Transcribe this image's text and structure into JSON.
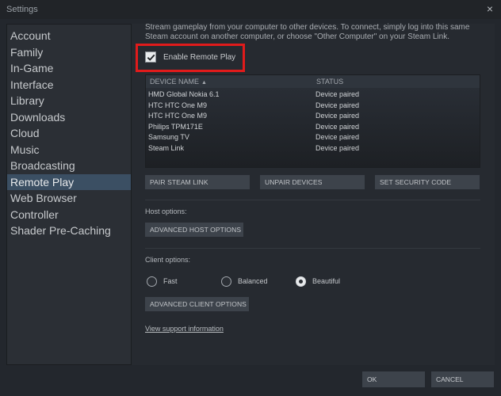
{
  "window": {
    "title": "Settings",
    "close_glyph": "×"
  },
  "sidebar": {
    "items": [
      {
        "label": "Account"
      },
      {
        "label": "Family"
      },
      {
        "label": "In-Game"
      },
      {
        "label": "Interface"
      },
      {
        "label": "Library"
      },
      {
        "label": "Downloads"
      },
      {
        "label": "Cloud"
      },
      {
        "label": "Music"
      },
      {
        "label": "Broadcasting"
      },
      {
        "label": "Remote Play"
      },
      {
        "label": "Web Browser"
      },
      {
        "label": "Controller"
      },
      {
        "label": "Shader Pre-Caching"
      }
    ],
    "active": "Remote Play"
  },
  "remote_play": {
    "description": "Stream gameplay from your computer to other devices. To connect, simply log into this same Steam account on another computer, or choose \"Other Computer\" on your Steam Link.",
    "enable_label": "Enable Remote Play",
    "enabled": true,
    "table": {
      "col_name": "DEVICE NAME",
      "sort_arrow": "▲",
      "col_status": "STATUS",
      "rows": [
        {
          "name": "HMD Global Nokia 6.1",
          "status": "Device paired"
        },
        {
          "name": "HTC HTC One M9",
          "status": "Device paired"
        },
        {
          "name": "HTC HTC One M9",
          "status": "Device paired"
        },
        {
          "name": "Philips TPM171E",
          "status": "Device paired"
        },
        {
          "name": "Samsung TV",
          "status": "Device paired"
        },
        {
          "name": "Steam Link",
          "status": "Device paired"
        }
      ]
    },
    "buttons": {
      "pair": "PAIR STEAM LINK",
      "unpair": "UNPAIR DEVICES",
      "security": "SET SECURITY CODE"
    },
    "host_options_label": "Host options:",
    "advanced_host": "ADVANCED HOST OPTIONS",
    "client_options_label": "Client options:",
    "client_quality": {
      "options": [
        "Fast",
        "Balanced",
        "Beautiful"
      ],
      "selected": "Beautiful"
    },
    "advanced_client": "ADVANCED CLIENT OPTIONS",
    "support_link": "View support information"
  },
  "footer": {
    "ok": "OK",
    "cancel": "CANCEL"
  },
  "colors": {
    "highlight": "#e11b1b",
    "active_item": "#3b4f63"
  }
}
